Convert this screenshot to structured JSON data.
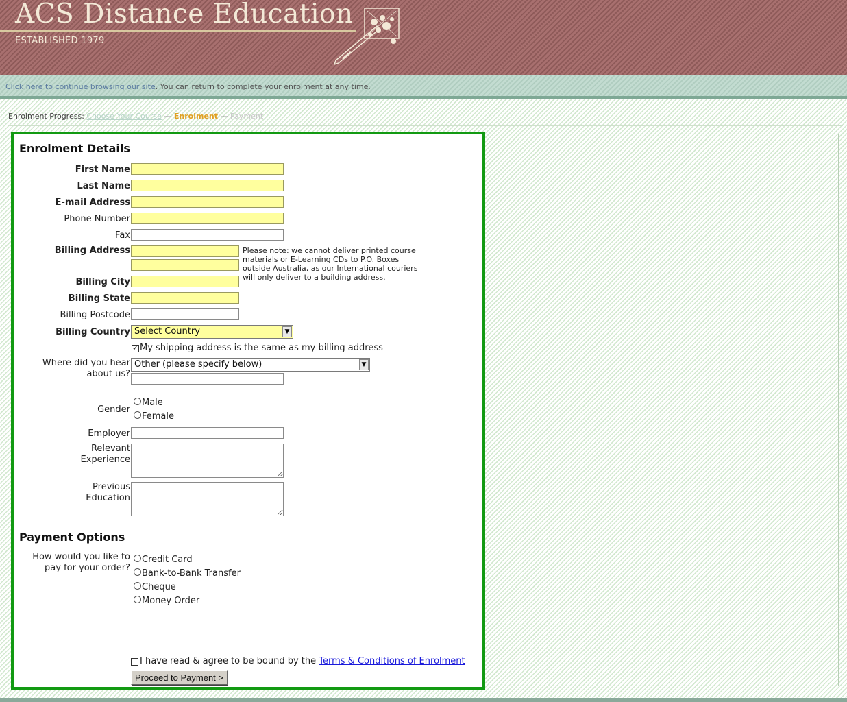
{
  "header": {
    "title": "ACS Distance Education",
    "established": "ESTABLISHED 1979"
  },
  "infobar": {
    "link_text": "Click here to continue browsing our site",
    "rest_text": ". You can return to complete your enrolment at any time."
  },
  "progress": {
    "label": "Enrolment Progress:",
    "steps": [
      "Choose Your Course",
      "Enrolment",
      "Payment"
    ],
    "separator": " — "
  },
  "enrolment": {
    "title": "Enrolment Details",
    "fields": {
      "first_name": {
        "label": "First Name",
        "value": ""
      },
      "last_name": {
        "label": "Last Name",
        "value": ""
      },
      "email": {
        "label": "E-mail Address",
        "value": ""
      },
      "phone": {
        "label": "Phone Number",
        "value": ""
      },
      "fax": {
        "label": "Fax",
        "value": ""
      },
      "billing_address": {
        "label": "Billing Address",
        "line1": "",
        "line2": ""
      },
      "billing_city": {
        "label": "Billing City",
        "value": ""
      },
      "billing_state": {
        "label": "Billing State",
        "value": ""
      },
      "billing_postcode": {
        "label": "Billing Postcode",
        "value": ""
      },
      "billing_country": {
        "label": "Billing Country",
        "selected": "Select Country"
      },
      "shipping_same": {
        "label": "My shipping address is the same as my billing address",
        "checked": true
      },
      "hear_about": {
        "label_line1": "Where did you hear",
        "label_line2": "about us?",
        "selected": "Other (please specify below)",
        "other_value": ""
      },
      "gender": {
        "label": "Gender",
        "options": [
          "Male",
          "Female"
        ]
      },
      "employer": {
        "label": "Employer",
        "value": ""
      },
      "experience": {
        "label_line1": "Relevant",
        "label_line2": "Experience",
        "value": ""
      },
      "education": {
        "label_line1": "Previous",
        "label_line2": "Education",
        "value": ""
      }
    },
    "note": "Please note: we cannot deliver printed course materials or E-Learning CDs to P.O. Boxes outside Australia, as our International couriers will only deliver to a building address."
  },
  "payment": {
    "title": "Payment Options",
    "question_line1": "How would you like to",
    "question_line2": "pay for your order?",
    "options": [
      "Credit Card",
      "Bank-to-Bank Transfer",
      "Cheque",
      "Money Order"
    ],
    "agree_text": "I have read & agree to be bound by the ",
    "terms_link": "Terms & Conditions of Enrolment",
    "agree_checked": false,
    "submit_label": "Proceed to Payment >"
  }
}
